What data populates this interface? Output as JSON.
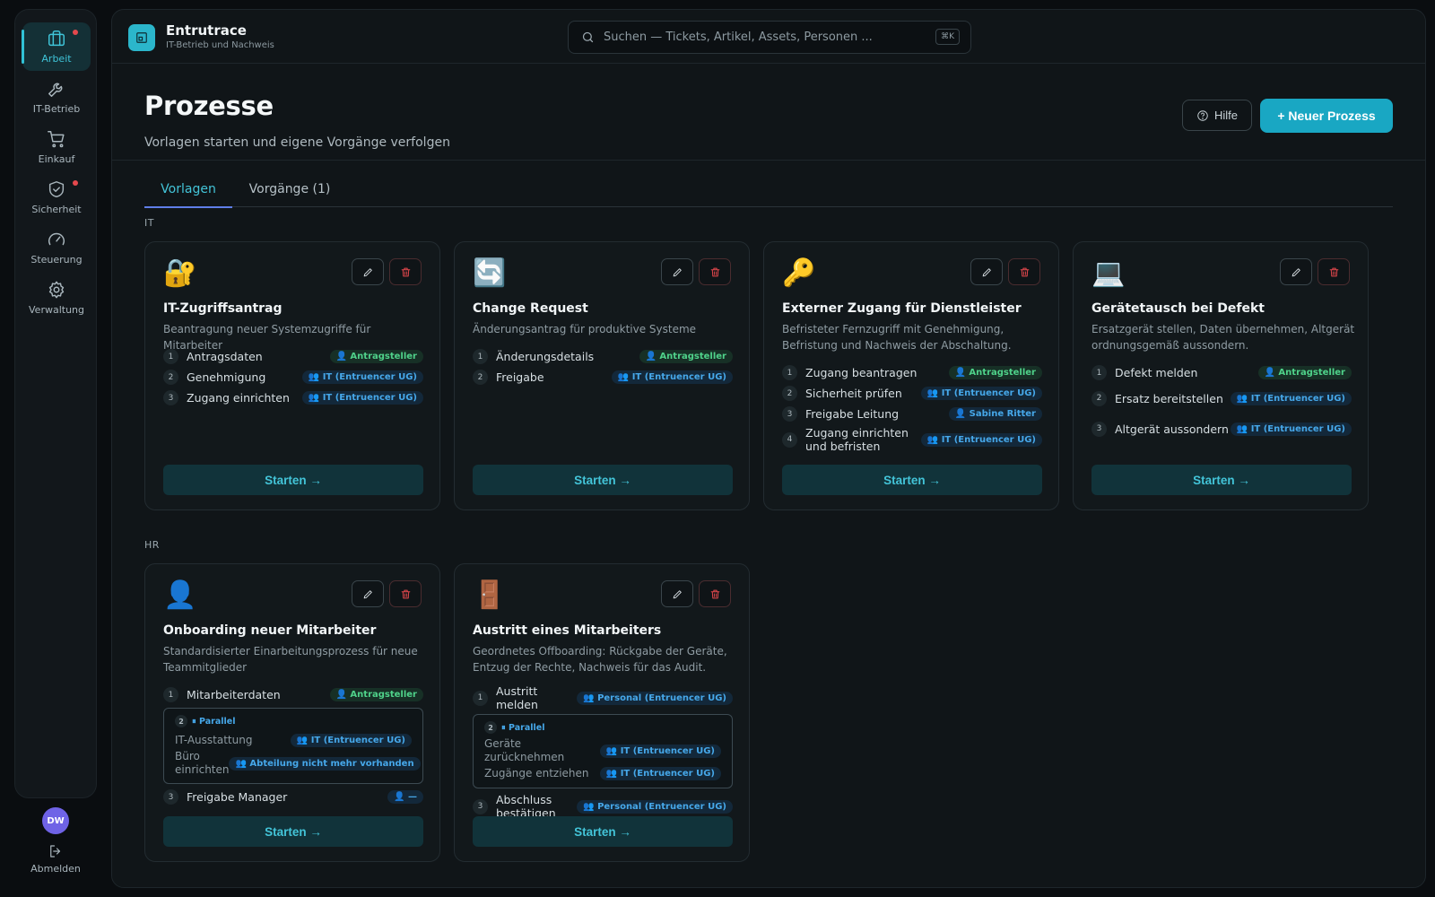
{
  "sidebar": {
    "items": [
      {
        "label": "Arbeit",
        "icon": "briefcase-icon",
        "active": true,
        "dot": true
      },
      {
        "label": "IT-Betrieb",
        "icon": "wrench-icon",
        "active": false,
        "dot": false
      },
      {
        "label": "Einkauf",
        "icon": "cart-icon",
        "active": false,
        "dot": false
      },
      {
        "label": "Sicherheit",
        "icon": "shield-icon",
        "active": false,
        "dot": true
      },
      {
        "label": "Steuerung",
        "icon": "gauge-icon",
        "active": false,
        "dot": false
      },
      {
        "label": "Verwaltung",
        "icon": "gear-icon",
        "active": false,
        "dot": false
      }
    ],
    "avatar": "DW",
    "logout_label": "Abmelden"
  },
  "topbar": {
    "brand_name": "Entrutrace",
    "brand_sub": "IT-Betrieb und Nachweis",
    "search_placeholder": "Suchen — Tickets, Artikel, Assets, Personen ...",
    "search_shortcut": "⌘K"
  },
  "header": {
    "title": "Prozesse",
    "subtitle": "Vorlagen starten und eigene Vorgänge verfolgen",
    "help_label": "Hilfe",
    "new_label": "+ Neuer Prozess"
  },
  "tabs": [
    {
      "label": "Vorlagen",
      "active": true
    },
    {
      "label": "Vorgänge (1)",
      "active": false
    }
  ],
  "start_label": "Starten →",
  "sections": [
    {
      "label": "IT",
      "cards": [
        {
          "icon": "🔐",
          "title": "IT-Zugriffsantrag",
          "desc": "Beantragung neuer Systemzugriffe für Mitarbeiter",
          "steps": [
            {
              "num": "1",
              "label": "Antragsdaten",
              "badge": "👤 Antragsteller",
              "tone": "green"
            },
            {
              "num": "2",
              "label": "Genehmigung",
              "badge": "👥 IT (Entruencer UG)",
              "tone": "blue"
            },
            {
              "num": "3",
              "label": "Zugang einrichten",
              "badge": "👥 IT (Entruencer UG)",
              "tone": "blue"
            }
          ]
        },
        {
          "icon": "🔄",
          "title": "Change Request",
          "desc": "Änderungsantrag für produktive Systeme",
          "steps": [
            {
              "num": "1",
              "label": "Änderungsdetails",
              "badge": "👤 Antragsteller",
              "tone": "green"
            },
            {
              "num": "2",
              "label": "Freigabe",
              "badge": "👥 IT (Entruencer UG)",
              "tone": "blue"
            }
          ]
        },
        {
          "icon": "🔑",
          "title": "Externer Zugang für Dienstleister",
          "desc": "Befristeter Fernzugriff mit Genehmigung, Befristung und Nachweis der Abschaltung.",
          "steps": [
            {
              "num": "1",
              "label": "Zugang beantragen",
              "badge": "👤 Antragsteller",
              "tone": "green"
            },
            {
              "num": "2",
              "label": "Sicherheit prüfen",
              "badge": "👥 IT (Entruencer UG)",
              "tone": "blue"
            },
            {
              "num": "3",
              "label": "Freigabe Leitung",
              "badge": "👤 Sabine Ritter",
              "tone": "blue"
            },
            {
              "num": "4",
              "label": "Zugang einrichten und befristen",
              "badge": "👥 IT (Entruencer UG)",
              "tone": "blue"
            }
          ]
        },
        {
          "icon": "💻",
          "title": "Gerätetausch bei Defekt",
          "desc": "Ersatzgerät stellen, Daten übernehmen, Altgerät ordnungsgemäß aussondern.",
          "steps": [
            {
              "num": "1",
              "label": "Defekt melden",
              "badge": "👤 Antragsteller",
              "tone": "green"
            },
            {
              "num": "2",
              "label": "Ersatz bereitstellen",
              "badge": "👥 IT (Entruencer UG)",
              "tone": "blue"
            },
            {
              "num": "3",
              "label": "Altgerät aussondern",
              "badge": "👥 IT (Entruencer UG)",
              "tone": "blue"
            }
          ]
        }
      ]
    },
    {
      "label": "HR",
      "cards": [
        {
          "icon": "👤",
          "title": "Onboarding neuer Mitarbeiter",
          "desc": "Standardisierter Einarbeitungsprozess für neue Teammitglieder",
          "steps": [
            {
              "num": "1",
              "label": "Mitarbeiterdaten",
              "badge": "👤 Antragsteller",
              "tone": "green"
            },
            {
              "num": "2",
              "parallel": true,
              "parallel_label": "⏸ Parallel",
              "rows": [
                {
                  "label": "IT-Ausstattung",
                  "badge": "👥 IT (Entruencer UG)",
                  "tone": "blue"
                },
                {
                  "label": "Büro einrichten",
                  "badge": "👥 Abteilung nicht mehr vorhanden",
                  "tone": "blue"
                }
              ]
            },
            {
              "num": "3",
              "label": "Freigabe Manager",
              "badge": "👤 —",
              "tone": "blue"
            }
          ]
        },
        {
          "icon": "🚪",
          "title": "Austritt eines Mitarbeiters",
          "desc": "Geordnetes Offboarding: Rückgabe der Geräte, Entzug der Rechte, Nachweis für das Audit.",
          "steps": [
            {
              "num": "1",
              "label": "Austritt melden",
              "badge": "👥 Personal (Entruencer UG)",
              "tone": "blue"
            },
            {
              "num": "2",
              "parallel": true,
              "parallel_label": "⏸ Parallel",
              "rows": [
                {
                  "label": "Geräte zurücknehmen",
                  "badge": "👥 IT (Entruencer UG)",
                  "tone": "blue"
                },
                {
                  "label": "Zugänge entziehen",
                  "badge": "👥 IT (Entruencer UG)",
                  "tone": "blue"
                }
              ]
            },
            {
              "num": "3",
              "label": "Abschluss bestätigen",
              "badge": "👥 Personal (Entruencer UG)",
              "tone": "blue"
            }
          ]
        }
      ]
    }
  ]
}
